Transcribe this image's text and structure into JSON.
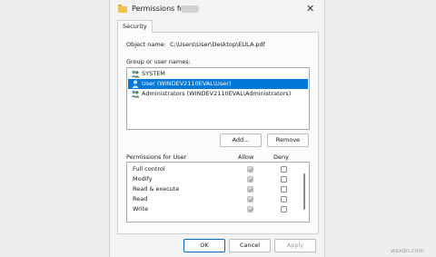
{
  "window": {
    "title": "Permissions for"
  },
  "tabs": [
    {
      "label": "Security"
    }
  ],
  "object": {
    "label": "Object name:",
    "value": "C:\\Users\\User\\Desktop\\EULA.pdf"
  },
  "groups": {
    "label": "Group or user names:",
    "items": [
      {
        "label": "SYSTEM",
        "icon": "users-group-icon",
        "selected": false
      },
      {
        "label": "User (WINDEV2110EVAL\\User)",
        "icon": "user-icon",
        "selected": true
      },
      {
        "label": "Administrators (WINDEV2110EVAL\\Administrators)",
        "icon": "users-group-icon",
        "selected": false
      }
    ]
  },
  "buttons": {
    "add": "Add...",
    "remove": "Remove",
    "ok": "OK",
    "cancel": "Cancel",
    "apply": "Apply"
  },
  "permissions": {
    "label": "Permissions for User",
    "allow_header": "Allow",
    "deny_header": "Deny",
    "rows": [
      {
        "name": "Full control",
        "allow": "checked-disabled",
        "deny": "unchecked"
      },
      {
        "name": "Modify",
        "allow": "checked-disabled",
        "deny": "unchecked"
      },
      {
        "name": "Read & execute",
        "allow": "checked-disabled",
        "deny": "unchecked"
      },
      {
        "name": "Read",
        "allow": "checked-disabled",
        "deny": "unchecked"
      },
      {
        "name": "Write",
        "allow": "checked-disabled",
        "deny": "unchecked"
      }
    ]
  },
  "watermark": "wsxdn.com",
  "colors": {
    "selection": "#0078d7",
    "primary_border": "#0067c0"
  }
}
